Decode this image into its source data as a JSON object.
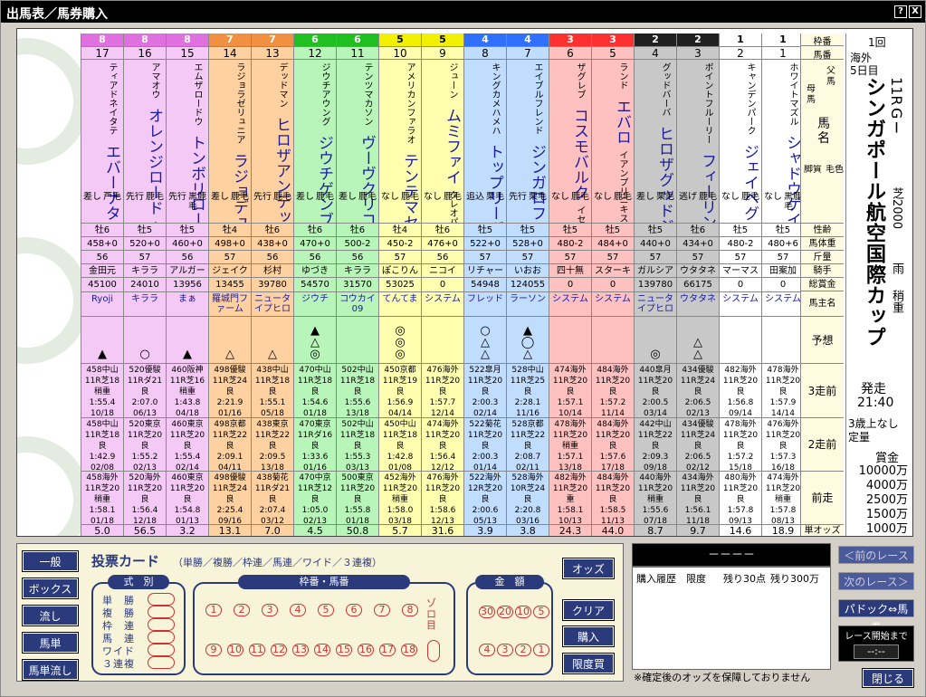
{
  "window": {
    "title": "出馬表／馬券購入",
    "help": "?",
    "close": "X"
  },
  "info": {
    "kai": "1回",
    "place": "海外",
    "nichime": "5日目",
    "race_no": "11R",
    "grade": "GⅠ",
    "race_name": "シンガポール航空国際カップ",
    "surface": "芝2000",
    "weather": "雨",
    "going": "稍重",
    "start_label": "発走",
    "start_time": "21:40",
    "cond1": "3歳上なし",
    "cond2": "定量",
    "prize_label": "賞金",
    "prizes": [
      "10000万",
      "4000万",
      "2500万",
      "1500万",
      "1000万"
    ]
  },
  "header": {
    "waku": "枠番",
    "umaban": "馬番",
    "chichi": "父馬",
    "haha": "母馬",
    "bamei": "馬名",
    "kyakushitsu": "脚質",
    "keiro": "毛色",
    "seirei": "性齢",
    "bataiju": "馬体重",
    "kinryo": "斤量",
    "kishu": "騎手",
    "sokaikin": "総賞金",
    "shuyo": "馬主名",
    "yoso": "予想",
    "zen3": "3走前",
    "zen2": "2走前",
    "zen1": "前走",
    "odds": "単オッズ"
  },
  "horses": [
    {
      "waku": "8",
      "num": "17",
      "sire": "ティアドネイタテ",
      "dam": "エバーユナイト",
      "name": "エバーナタルシア",
      "style": "差し",
      "coat": "芦毛",
      "sexage": "牡6",
      "weight": "458+0",
      "kin": "56",
      "jockey": "金田元",
      "money": "45100",
      "owner": "Ryoji",
      "marks": [
        "",
        "▲"
      ],
      "p3": [
        "458中山",
        "11R芝18",
        "稍重",
        "1:55.4",
        "10/18"
      ],
      "p2": [
        "458中山",
        "11R芝18",
        "良",
        "1:42.9",
        "02/08"
      ],
      "p1": [
        "458海外",
        "11R芝20",
        "稍重",
        "1:58.1",
        "01/18"
      ],
      "odds": "5.0"
    },
    {
      "waku": "8",
      "num": "16",
      "sire": "アマオウ",
      "dam": "カミノユウウヤ",
      "name": "オレンジロード",
      "style": "先行",
      "coat": "鹿毛",
      "sexage": "牡5",
      "weight": "520+0",
      "kin": "57",
      "jockey": "キララ",
      "money": "24010",
      "owner": "キララ",
      "marks": [
        "○",
        ""
      ],
      "p3": [
        "520優駿",
        "11Rダ21",
        "良",
        "2:07.0",
        "06/13"
      ],
      "p2": [
        "520東京",
        "11R芝20",
        "良",
        "1:55.2",
        "02/13"
      ],
      "p1": [
        "520海外",
        "11R芝20",
        "良",
        "1:56.4",
        "12/18"
      ],
      "odds": "56.5"
    },
    {
      "waku": "8",
      "num": "15",
      "sire": "エムザロードウ",
      "dam": "エムアテロージキンガー",
      "name": "トンボリローキン",
      "style": "先行",
      "coat": "黒鹿毛",
      "sexage": "牡5",
      "weight": "460+0",
      "kin": "56",
      "jockey": "アルガー",
      "money": "13956",
      "owner": "まぁ",
      "marks": [
        "",
        "▲"
      ],
      "p3": [
        "460阪神",
        "11R芝16",
        "稍重",
        "1:43.8",
        "04/18"
      ],
      "p2": [
        "460東京",
        "11R芝20",
        "良",
        "1:55.4",
        "02/14"
      ],
      "p1": [
        "460東京",
        "11R芝20",
        "良",
        "1:54.8",
        "01/13"
      ],
      "odds": "3.2"
    },
    {
      "waku": "7",
      "num": "14",
      "sire": "ラジョラゼリュニア",
      "dam": "ラジョウオイシュ",
      "name": "ラジョデュランテ",
      "style": "差し",
      "coat": "鹿毛",
      "sexage": "牡4",
      "weight": "498+0",
      "kin": "57",
      "jockey": "ジェイク",
      "money": "13455",
      "owner": "羅城門ファーム",
      "marks": [
        "",
        "△"
      ],
      "p3": [
        "498優駿",
        "11R芝24",
        "良",
        "2:21.9",
        "01/16"
      ],
      "p2": [
        "498京都",
        "11R芝22",
        "良",
        "2:09.1",
        "04/11"
      ],
      "p1": [
        "498優駿",
        "11R芝24",
        "良",
        "2:25.4",
        "09/16"
      ],
      "odds": "13.1"
    },
    {
      "waku": "7",
      "num": "13",
      "sire": "デッドマン",
      "dam": "ヒロザヨロシコ",
      "name": "ヒロザアンデッド",
      "style": "先行",
      "coat": "鹿毛",
      "sexage": "牡6",
      "weight": "438+0",
      "kin": "56",
      "jockey": "杉村",
      "money": "39780",
      "owner": "ニュータイプヒロ",
      "marks": [
        "△",
        ""
      ],
      "p3": [
        "438中山",
        "11R芝18",
        "良",
        "1:55.1",
        "05/18"
      ],
      "p2": [
        "438東京",
        "11R芝22",
        "良",
        "2:09.5",
        "13/18"
      ],
      "p1": [
        "438菊花",
        "11Rダ21",
        "良",
        "2:07.4",
        "03/12"
      ],
      "odds": "7.0"
    },
    {
      "waku": "6",
      "num": "12",
      "sire": "ジウチアウング",
      "dam": "ジウチウンポー",
      "name": "ジウチゲンブー",
      "style": "差し",
      "coat": "鹿毛",
      "sexage": "牡6",
      "weight": "470+0",
      "kin": "56",
      "jockey": "ゆづき",
      "money": "54570",
      "owner": "ジウチ",
      "marks": [
        "▲",
        "△",
        "◎"
      ],
      "p3": [
        "470中山",
        "11R芝18",
        "良",
        "1:54.6",
        "01/18"
      ],
      "p2": [
        "470東京",
        "11Rダ16",
        "良",
        "1:33.6",
        "01/16"
      ],
      "p1": [
        "470中京",
        "11R芝12",
        "良",
        "1:05.0",
        "02/13"
      ],
      "odds": "4.5"
    },
    {
      "waku": "6",
      "num": "11",
      "sire": "テンツマカソン",
      "dam": "ヴーラ",
      "name": "ヴーヴクリコ",
      "style": "差し",
      "coat": "鹿毛",
      "sexage": "牡6",
      "weight": "500-2",
      "kin": "56",
      "jockey": "キララ",
      "money": "31570",
      "owner": "コウカイ09",
      "marks": [
        "",
        ""
      ],
      "p3": [
        "502中山",
        "11R芝18",
        "良",
        "1:55.6",
        "13/18"
      ],
      "p2": [
        "502中山",
        "11R芝18",
        "良",
        "1:55.3",
        "03/13"
      ],
      "p1": [
        "500東京",
        "11R芝20",
        "良",
        "1:55.8",
        "01/18"
      ],
      "odds": "50.8"
    },
    {
      "waku": "5",
      "num": "10",
      "sire": "アメリカンファラオ",
      "dam": "ソレミア",
      "name": "テンテマセイヴァー",
      "style": "なし",
      "coat": "鹿毛",
      "sexage": "牡4",
      "weight": "450-2",
      "kin": "57",
      "jockey": "ぽこりん",
      "money": "53025",
      "owner": "てんてま",
      "marks": [
        "◎",
        "◎",
        "◎"
      ],
      "p3": [
        "450京都",
        "11R芝19",
        "良",
        "1:56.9",
        "04/14"
      ],
      "p2": [
        "450中山",
        "11R芝18",
        "良",
        "1:42.8",
        "01/08"
      ],
      "p1": [
        "452海外",
        "11R芝20",
        "稍重",
        "1:58.0",
        "03/18"
      ],
      "odds": "5.7"
    },
    {
      "waku": "5",
      "num": "9",
      "sire": "ジューン",
      "dam": "クレオパトラバール",
      "name": "ムミファイ",
      "style": "なし",
      "coat": "鹿毛",
      "sexage": "牡6",
      "weight": "476+0",
      "kin": "56",
      "jockey": "ニコイ",
      "money": "0",
      "owner": "システム",
      "marks": [
        "",
        ""
      ],
      "p3": [
        "476海外",
        "11R芝20",
        "良",
        "1:57.7",
        "12/14"
      ],
      "p2": [
        "474海外",
        "11R芝20",
        "良",
        "1:56.4",
        "12/12"
      ],
      "p1": [
        "476海外",
        "11R芝20",
        "良",
        "1:58.6",
        "12/13"
      ],
      "odds": "31.6"
    },
    {
      "waku": "4",
      "num": "8",
      "sire": "キングカメハメハ",
      "dam": "ポリシーダンタ",
      "name": "トップリーダー",
      "style": "追込",
      "coat": "栗毛",
      "sexage": "牡5",
      "weight": "522+0",
      "kin": "57",
      "jockey": "リチャー",
      "money": "54948",
      "owner": "フレッド",
      "marks": [
        "○",
        "△",
        "△"
      ],
      "p3": [
        "522皐月",
        "11R芝20",
        "良",
        "2:00.3",
        "02/14"
      ],
      "p2": [
        "522菊花",
        "11R芝20",
        "良",
        "2:00.3",
        "01/14"
      ],
      "p1": [
        "522海外",
        "12R芝20",
        "良",
        "2:00.6",
        "05/13"
      ],
      "odds": "3.9"
    },
    {
      "waku": "4",
      "num": "7",
      "sire": "エイブルフレンド",
      "dam": "ジンガロフェリタイ",
      "name": "ジンガロフレンド",
      "style": "先行",
      "coat": "栗毛",
      "sexage": "牡5",
      "weight": "528+0",
      "kin": "57",
      "jockey": "いおお",
      "money": "124055",
      "owner": "ラーソン",
      "marks": [
        "▲",
        "◯",
        "△"
      ],
      "p3": [
        "528中山",
        "11R芝25",
        "良",
        "2:28.1",
        "11/16"
      ],
      "p2": [
        "528京都",
        "11R芝22",
        "良",
        "2:08.7",
        "02/11"
      ],
      "p1": [
        "528海外",
        "10R芝24",
        "良",
        "2:20.8",
        "03/16"
      ],
      "odds": "3.8"
    },
    {
      "waku": "3",
      "num": "6",
      "sire": "ザグレブ",
      "dam": "イセノトショウ",
      "name": "コスモバルク",
      "style": "なし",
      "coat": "鹿毛",
      "sexage": "牡5",
      "weight": "480-2",
      "kin": "57",
      "jockey": "四十無",
      "money": "0",
      "owner": "システム",
      "marks": [
        "",
        ""
      ],
      "p3": [
        "474海外",
        "11R芝20",
        "良",
        "1:57.1",
        "10/14"
      ],
      "p2": [
        "478海外",
        "11R芝20",
        "稍重",
        "1:57.1",
        "13/18"
      ],
      "p1": [
        "482海外",
        "11R芝20",
        "重",
        "1:58.1",
        "10/13"
      ],
      "odds": "24.3"
    },
    {
      "waku": "3",
      "num": "5",
      "sire": "ランド",
      "dam": "イアンプリニキス",
      "name": "エバロ",
      "style": "なし",
      "coat": "鹿毛",
      "sexage": "牡5",
      "weight": "484+0",
      "kin": "57",
      "jockey": "スターキ",
      "money": "0",
      "owner": "システム",
      "marks": [
        "",
        ""
      ],
      "p3": [
        "484海外",
        "11R芝20",
        "良",
        "1:57.2",
        "11/14"
      ],
      "p2": [
        "484海外",
        "11R芝20",
        "良",
        "1:57.6",
        "17/18"
      ],
      "p1": [
        "484海外",
        "11R芝20",
        "良",
        "1:58.5",
        "11/13"
      ],
      "odds": "44.0"
    },
    {
      "waku": "2",
      "num": "4",
      "sire": "グッドバーバ",
      "dam": "ヒロザメロディ",
      "name": "ヒロザグッドジジ",
      "style": "差し",
      "coat": "栗毛",
      "sexage": "牡5",
      "weight": "440+0",
      "kin": "57",
      "jockey": "ガルシア",
      "money": "139780",
      "owner": "ニュータイプヒロ",
      "marks": [
        "◎",
        ""
      ],
      "p3": [
        "440皐月",
        "11R芝20",
        "良",
        "2:00.5",
        "03/14"
      ],
      "p2": [
        "442中山",
        "11R芝22",
        "良",
        "2:09.3",
        "09/18"
      ],
      "p1": [
        "440海外",
        "11R芝20",
        "稍重",
        "1:55.6",
        "07/18"
      ],
      "odds": "8.7"
    },
    {
      "waku": "2",
      "num": "3",
      "sire": "ボイントフルーリー",
      "dam": "フィーリングウッド",
      "name": "フィーリンギウン",
      "style": "逃げ",
      "coat": "鹿毛",
      "sexage": "牡6",
      "weight": "434+0",
      "kin": "57",
      "jockey": "ウタタネ",
      "money": "66175",
      "owner": "ウタタネ",
      "marks": [
        "△",
        "△"
      ],
      "p3": [
        "434優駿",
        "11R芝24",
        "良",
        "2:06.5",
        "02/13"
      ],
      "p2": [
        "434優駿",
        "11R芝24",
        "良",
        "2:06.5",
        "02/12"
      ],
      "p1": [
        "434海外",
        "11R芝20",
        "良",
        "1:56.1",
        "11/18"
      ],
      "odds": "9.7"
    },
    {
      "waku": "1",
      "num": "2",
      "sire": "キャンデンパーク",
      "dam": "ラップトップデフィ",
      "name": "ジェイベグ",
      "style": "なし",
      "coat": "鹿毛",
      "sexage": "牡5",
      "weight": "480-2",
      "kin": "57",
      "jockey": "マーマス",
      "money": "0",
      "owner": "システム",
      "marks": [
        "",
        ""
      ],
      "p3": [
        "482海外",
        "11R芝20",
        "良",
        "1:56.8",
        "09/14"
      ],
      "p2": [
        "478海外",
        "11R芝20",
        "良",
        "1:57.2",
        "15/18"
      ],
      "p1": [
        "480海外",
        "11R芝20",
        "良",
        "1:57.8",
        "09/13"
      ],
      "odds": "14.6"
    },
    {
      "waku": "1",
      "num": "1",
      "sire": "ホワイトマズル",
      "dam": "ファビラスター",
      "name": "シャドウゲイト",
      "style": "なし",
      "coat": "黒鹿毛",
      "sexage": "牡5",
      "weight": "480+6",
      "kin": "57",
      "jockey": "田案加",
      "money": "0",
      "owner": "システム",
      "marks": [
        "",
        ""
      ],
      "p3": [
        "478海外",
        "11R芝20",
        "良",
        "1:57.9",
        "14/14"
      ],
      "p2": [
        "476海外",
        "11R芝20",
        "良",
        "1:57.3",
        "16/18"
      ],
      "p1": [
        "474海外",
        "11R芝20",
        "稍重",
        "1:57.8",
        "08/13"
      ],
      "odds": "18.9"
    }
  ],
  "waku_colors": {
    "8": "#f5c9f5",
    "7": "#ffd0a0",
    "6": "#b8f5b8",
    "5": "#ffffb0",
    "4": "#c0dcff",
    "3": "#ffc0c0",
    "2": "#c8c8c8",
    "1": "#ffffff"
  },
  "waku_head_colors": {
    "8": "#e070e0",
    "7": "#f09040",
    "6": "#20c020",
    "5": "#f0f000",
    "4": "#3070ff",
    "3": "#ff3030",
    "2": "#202020",
    "1": "#ffffff"
  },
  "left_buttons": [
    "一般",
    "ボックス",
    "流し",
    "馬単",
    "馬単流し"
  ],
  "ticket": {
    "title": "投票カード",
    "subtitle": "（単勝／複勝／枠連／馬連／ワイド／３連複）",
    "shiki_label": "式　別",
    "shiki": [
      "単　勝",
      "複　勝",
      "枠　連",
      "馬　連",
      "ワイド",
      "３連複"
    ],
    "umaban_label": "枠番・馬番",
    "row1": [
      "1",
      "2",
      "3",
      "4",
      "5",
      "6",
      "7",
      "8"
    ],
    "row2": [
      "9",
      "10",
      "11",
      "12",
      "13",
      "14",
      "15",
      "16",
      "17",
      "18"
    ],
    "zoro": "ゾロ目",
    "kingaku_label": "金　額",
    "amount1": [
      "30",
      "20",
      "10",
      "5"
    ],
    "amount2": [
      "4",
      "3",
      "2",
      "1"
    ]
  },
  "right_buttons": {
    "odds": "オッズ",
    "clear": "クリア",
    "buy": "購入",
    "limit": "限度買"
  },
  "history": {
    "header": "－－－－",
    "label": "購入履歴　限度",
    "left30": "残り30点",
    "left300": "残り300万",
    "note": "※確定後のオッズを保障しておりません"
  },
  "nav": {
    "prev": "＜前のレース",
    "next": "次のレース＞",
    "paddock": "パドック⇔馬券",
    "until": "レース開始まで",
    "clock": "--:--",
    "close": "閉じる"
  }
}
